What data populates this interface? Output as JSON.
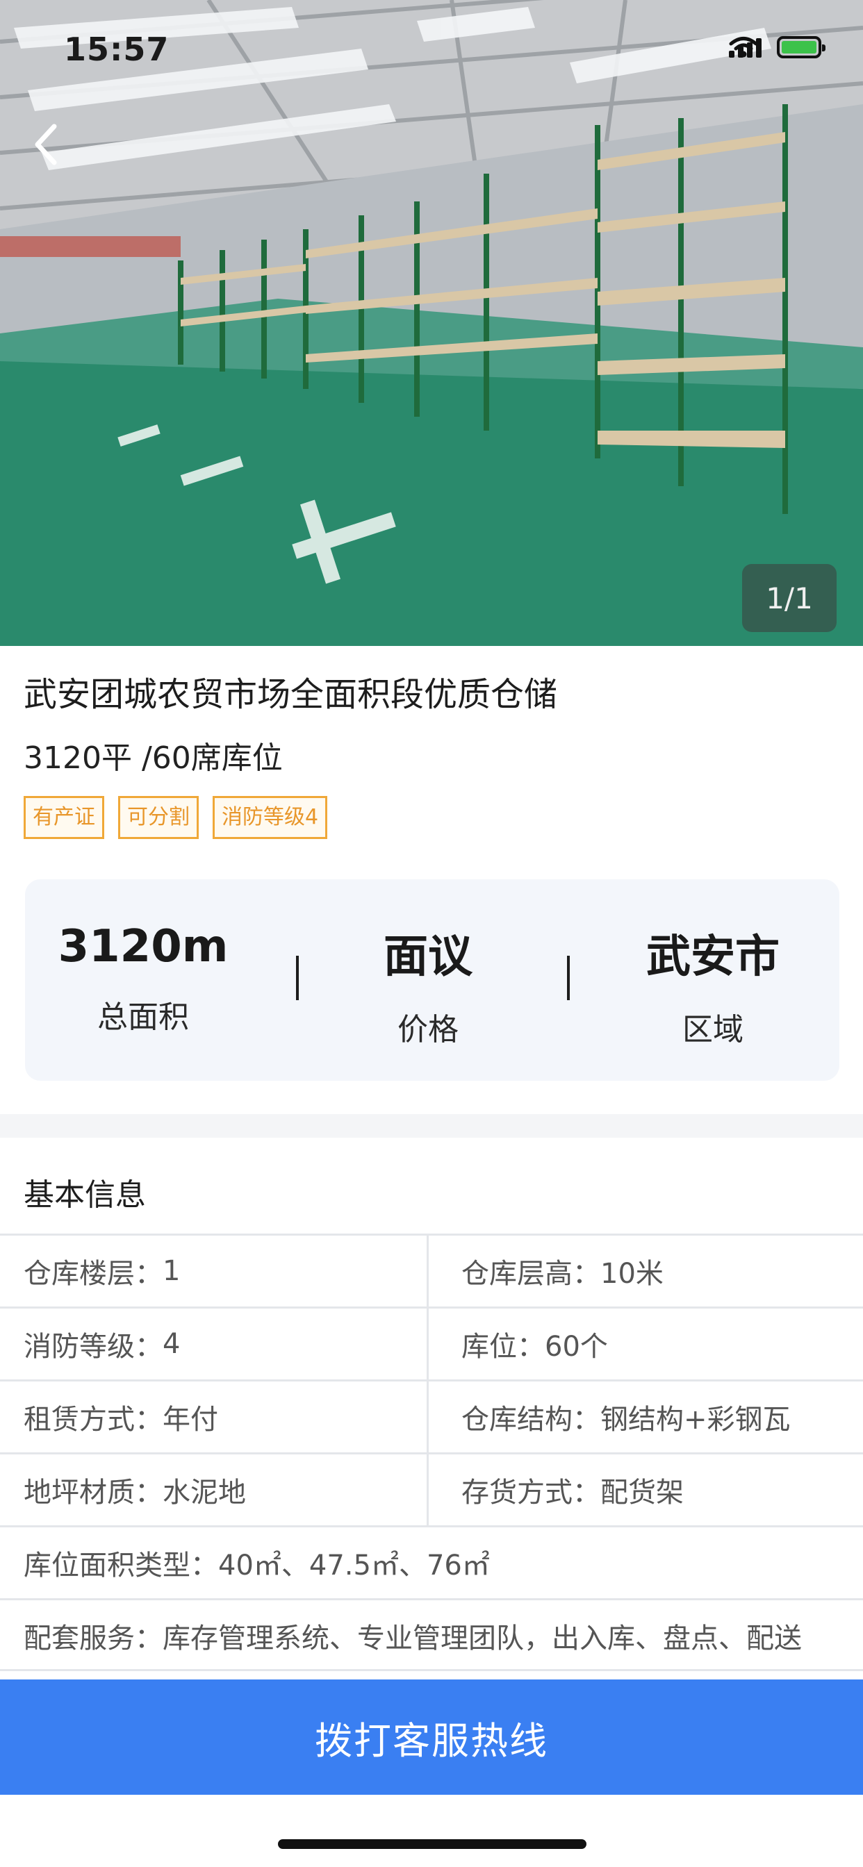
{
  "status_bar": {
    "time": "15:57"
  },
  "gallery": {
    "counter": "1/1"
  },
  "listing": {
    "title": "武安团城农贸市场全面积段优质仓储",
    "subtitle": "3120平 /60席库位",
    "tags": [
      "有产证",
      "可分割",
      "消防等级4"
    ]
  },
  "stats": [
    {
      "value": "3120m",
      "label": "总面积"
    },
    {
      "value": "面议",
      "label": "价格"
    },
    {
      "value": "武安市",
      "label": "区域"
    }
  ],
  "basic_info": {
    "title": "基本信息",
    "rows": [
      [
        {
          "label": "仓库楼层：",
          "value": "1"
        },
        {
          "label": "仓库层高：",
          "value": "10米"
        }
      ],
      [
        {
          "label": "消防等级：",
          "value": "4"
        },
        {
          "label": "库位：",
          "value": "60个"
        }
      ],
      [
        {
          "label": "租赁方式：",
          "value": "年付"
        },
        {
          "label": "仓库结构：",
          "value": "钢结构+彩钢瓦"
        }
      ],
      [
        {
          "label": "地坪材质：",
          "value": "水泥地"
        },
        {
          "label": "存货方式：",
          "value": "配货架"
        }
      ]
    ],
    "full_rows": [
      {
        "label": "库位面积类型：",
        "value": "40㎡、47.5㎡、76㎡"
      },
      {
        "label": "配套服务：",
        "value": "库存管理系统、专业管理团队，出入库、盘点、配送"
      }
    ]
  },
  "call_button": {
    "label": "拨打客服热线"
  },
  "icons": {
    "back": "chevron-left-icon",
    "signal": "signal-icon",
    "wifi": "wifi-icon",
    "battery": "battery-charging-icon"
  },
  "colors": {
    "accent": "#3a7ff2",
    "tag_border": "#f0a838",
    "tag_text": "#e8962a",
    "stats_bg": "#f3f6fb"
  }
}
